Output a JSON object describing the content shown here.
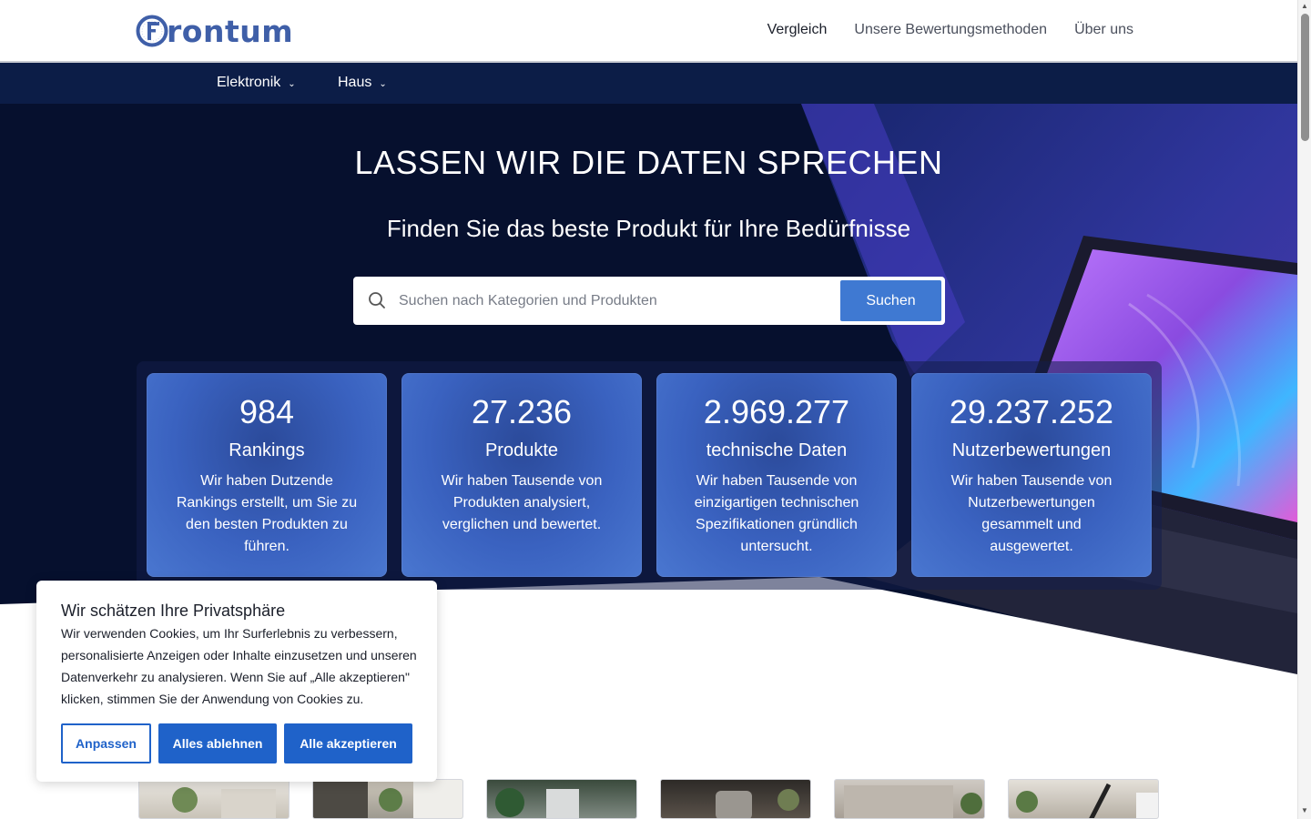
{
  "header": {
    "logo_text": "rontum",
    "logo_alt": "Frontum",
    "nav": [
      {
        "label": "Vergleich"
      },
      {
        "label": "Unsere Bewertungsmethoden"
      },
      {
        "label": "Über uns"
      }
    ]
  },
  "categories": [
    {
      "label": "Elektronik"
    },
    {
      "label": "Haus"
    }
  ],
  "hero": {
    "title": "LASSEN WIR DIE DATEN SPRECHEN",
    "subtitle": "Finden Sie das beste Produkt für Ihre Bedürfnisse",
    "search": {
      "placeholder": "Suchen nach Kategorien und Produkten",
      "button_label": "Suchen"
    }
  },
  "stats": [
    {
      "number": "984",
      "label": "Rankings",
      "description": "Wir haben Dutzende Rankings erstellt, um Sie zu den besten Produkten zu führen."
    },
    {
      "number": "27.236",
      "label": "Produkte",
      "description": "Wir haben Tausende von Produkten analysiert, verglichen und bewertet."
    },
    {
      "number": "2.969.277",
      "label": "technische Daten",
      "description": "Wir haben Tausende von einzigartigen technischen Spezifikationen gründlich untersucht."
    },
    {
      "number": "29.237.252",
      "label": "Nutzerbewertungen",
      "description": "Wir haben Tausende von Nutzerbewertungen gesammelt und ausgewertet."
    }
  ],
  "cookie": {
    "title": "Wir schätzen Ihre Privatsphäre",
    "text": "Wir verwenden Cookies, um Ihr Surferlebnis zu verbessern, personalisierte Anzeigen oder Inhalte einzusetzen und unseren Datenverkehr zu analysieren. Wenn Sie auf „Alle akzeptieren\" klicken, stimmen Sie der Anwendung von Cookies zu.",
    "btn_customize": "Anpassen",
    "btn_reject": "Alles ablehnen",
    "btn_accept": "Alle akzeptieren"
  },
  "colors": {
    "brand": "#3f5fa8",
    "nav_bar": "#0c1d47",
    "hero_bg": "#06102e",
    "accent_button": "#1f62c9",
    "search_button": "#3f79d2"
  }
}
